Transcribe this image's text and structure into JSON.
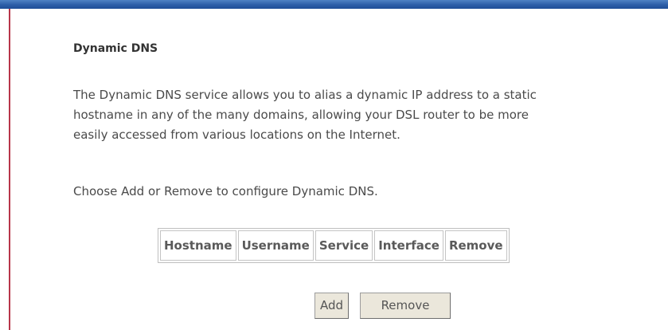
{
  "page": {
    "title": "Dynamic DNS",
    "description_lines": [
      "The Dynamic DNS service allows you to alias a dynamic IP address to a static",
      "hostname in any of the many domains, allowing your DSL router to be more",
      "easily accessed from various locations on the Internet."
    ],
    "instruction": "Choose Add or Remove to configure Dynamic DNS."
  },
  "table": {
    "columns": [
      "Hostname",
      "Username",
      "Service",
      "Interface",
      "Remove"
    ]
  },
  "buttons": {
    "add_label": "Add",
    "remove_label": "Remove"
  },
  "colors": {
    "top_bar": "#2c5ea8",
    "left_rule": "#b8364a",
    "button_face": "#ebe7db"
  }
}
